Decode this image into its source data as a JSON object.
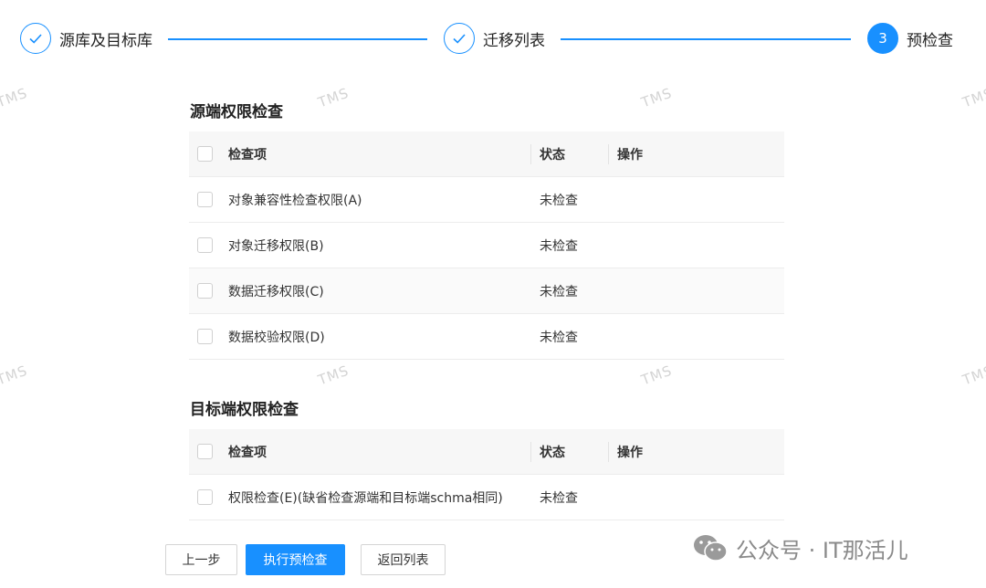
{
  "steps": [
    {
      "label": "源库及目标库",
      "state": "done"
    },
    {
      "label": "迁移列表",
      "state": "done"
    },
    {
      "label": "预检查",
      "state": "active",
      "number": "3"
    }
  ],
  "watermark": "TMS",
  "source_section": {
    "title": "源端权限检查",
    "headers": {
      "item": "检查项",
      "status": "状态",
      "action": "操作"
    },
    "rows": [
      {
        "name": "对象兼容性检查权限(A)",
        "status": "未检查"
      },
      {
        "name": "对象迁移权限(B)",
        "status": "未检查"
      },
      {
        "name": "数据迁移权限(C)",
        "status": "未检查"
      },
      {
        "name": "数据校验权限(D)",
        "status": "未检查"
      }
    ]
  },
  "target_section": {
    "title": "目标端权限检查",
    "headers": {
      "item": "检查项",
      "status": "状态",
      "action": "操作"
    },
    "rows": [
      {
        "name": "权限检查(E)(缺省检查源端和目标端schma相同)",
        "status": "未检查"
      }
    ]
  },
  "buttons": {
    "prev": "上一步",
    "run": "执行预检查",
    "back": "返回列表"
  },
  "brand": {
    "text": "公众号 · IT那活儿",
    "icon": "wechat-icon"
  },
  "colors": {
    "accent": "#1890ff",
    "header_bg": "#f7f7f7"
  }
}
